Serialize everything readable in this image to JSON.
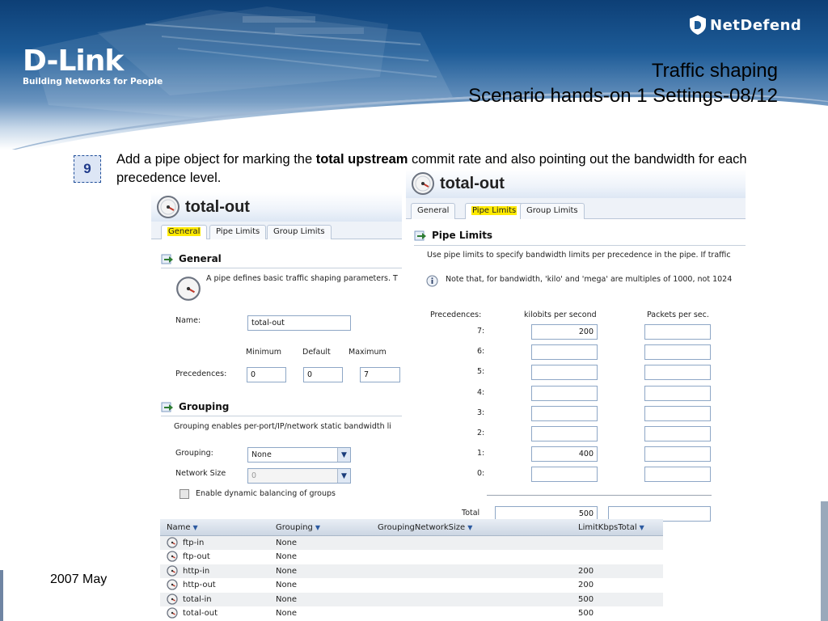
{
  "slide": {
    "title_line1": "Traffic shaping",
    "title_line2": "Scenario hands-on 1 Settings-08/12",
    "logo": {
      "name": "D-Link",
      "tagline": "Building Networks for People"
    },
    "brand": "NetDefend",
    "step_number": "9",
    "instruction_pre": "Add a pipe object for marking the ",
    "instruction_bold": "total upstream",
    "instruction_post": " commit rate and also pointing out the bandwidth for each precedence level.",
    "footer_date": "2007 May"
  },
  "general_window": {
    "title": "total-out",
    "tabs": [
      "General",
      "Pipe Limits",
      "Group Limits"
    ],
    "active_tab": "General",
    "general_section": {
      "heading": "General",
      "description": "A pipe defines basic traffic shaping parameters. T",
      "name_label": "Name:",
      "name_value": "total-out",
      "col_minimum": "Minimum",
      "col_default": "Default",
      "col_maximum": "Maximum",
      "precedences_label": "Precedences:",
      "precedence_min": "0",
      "precedence_default": "0",
      "precedence_max": "7"
    },
    "grouping_section": {
      "heading": "Grouping",
      "description": "Grouping enables per-port/IP/network static bandwidth li",
      "grouping_label": "Grouping:",
      "grouping_value": "None",
      "network_size_label": "Network Size",
      "network_size_value": "0",
      "dynamic_balancing_label": "Enable dynamic balancing of groups"
    }
  },
  "pipe_limits_window": {
    "title": "total-out",
    "tabs": [
      "General",
      "Pipe Limits",
      "Group Limits"
    ],
    "active_tab": "Pipe Limits",
    "heading": "Pipe Limits",
    "description": "Use pipe limits to specify bandwidth limits per precedence in the pipe. If traffic",
    "note": "Note that, for bandwidth, 'kilo' and 'mega' are multiples of 1000, not 1024",
    "col_precedences": "Precedences:",
    "col_kbps": "kilobits per second",
    "col_pps": "Packets per sec.",
    "rows": [
      {
        "label": "7:",
        "kbps": "200",
        "pps": ""
      },
      {
        "label": "6:",
        "kbps": "",
        "pps": ""
      },
      {
        "label": "5:",
        "kbps": "",
        "pps": ""
      },
      {
        "label": "4:",
        "kbps": "",
        "pps": ""
      },
      {
        "label": "3:",
        "kbps": "",
        "pps": ""
      },
      {
        "label": "2:",
        "kbps": "",
        "pps": ""
      },
      {
        "label": "1:",
        "kbps": "400",
        "pps": ""
      },
      {
        "label": "0:",
        "kbps": "",
        "pps": ""
      }
    ],
    "total_label": "Total",
    "total_kbps": "500",
    "total_pps": ""
  },
  "pipe_list": {
    "columns": [
      "Name",
      "Grouping",
      "GroupingNetworkSize",
      "LimitKbpsTotal"
    ],
    "rows": [
      {
        "name": "ftp-in",
        "grouping": "None",
        "limit": ""
      },
      {
        "name": "ftp-out",
        "grouping": "None",
        "limit": ""
      },
      {
        "name": "http-in",
        "grouping": "None",
        "limit": "200"
      },
      {
        "name": "http-out",
        "grouping": "None",
        "limit": "200"
      },
      {
        "name": "total-in",
        "grouping": "None",
        "limit": "500"
      },
      {
        "name": "total-out",
        "grouping": "None",
        "limit": "500"
      }
    ]
  },
  "colors": {
    "header_dark": "#0d3f76",
    "tab_highlight": "#ffea00",
    "badge_border": "#1f4e99"
  },
  "icons": [
    "gauge-icon",
    "section-arrow-icon",
    "info-icon",
    "dropdown-arrow-icon",
    "shield-icon"
  ]
}
